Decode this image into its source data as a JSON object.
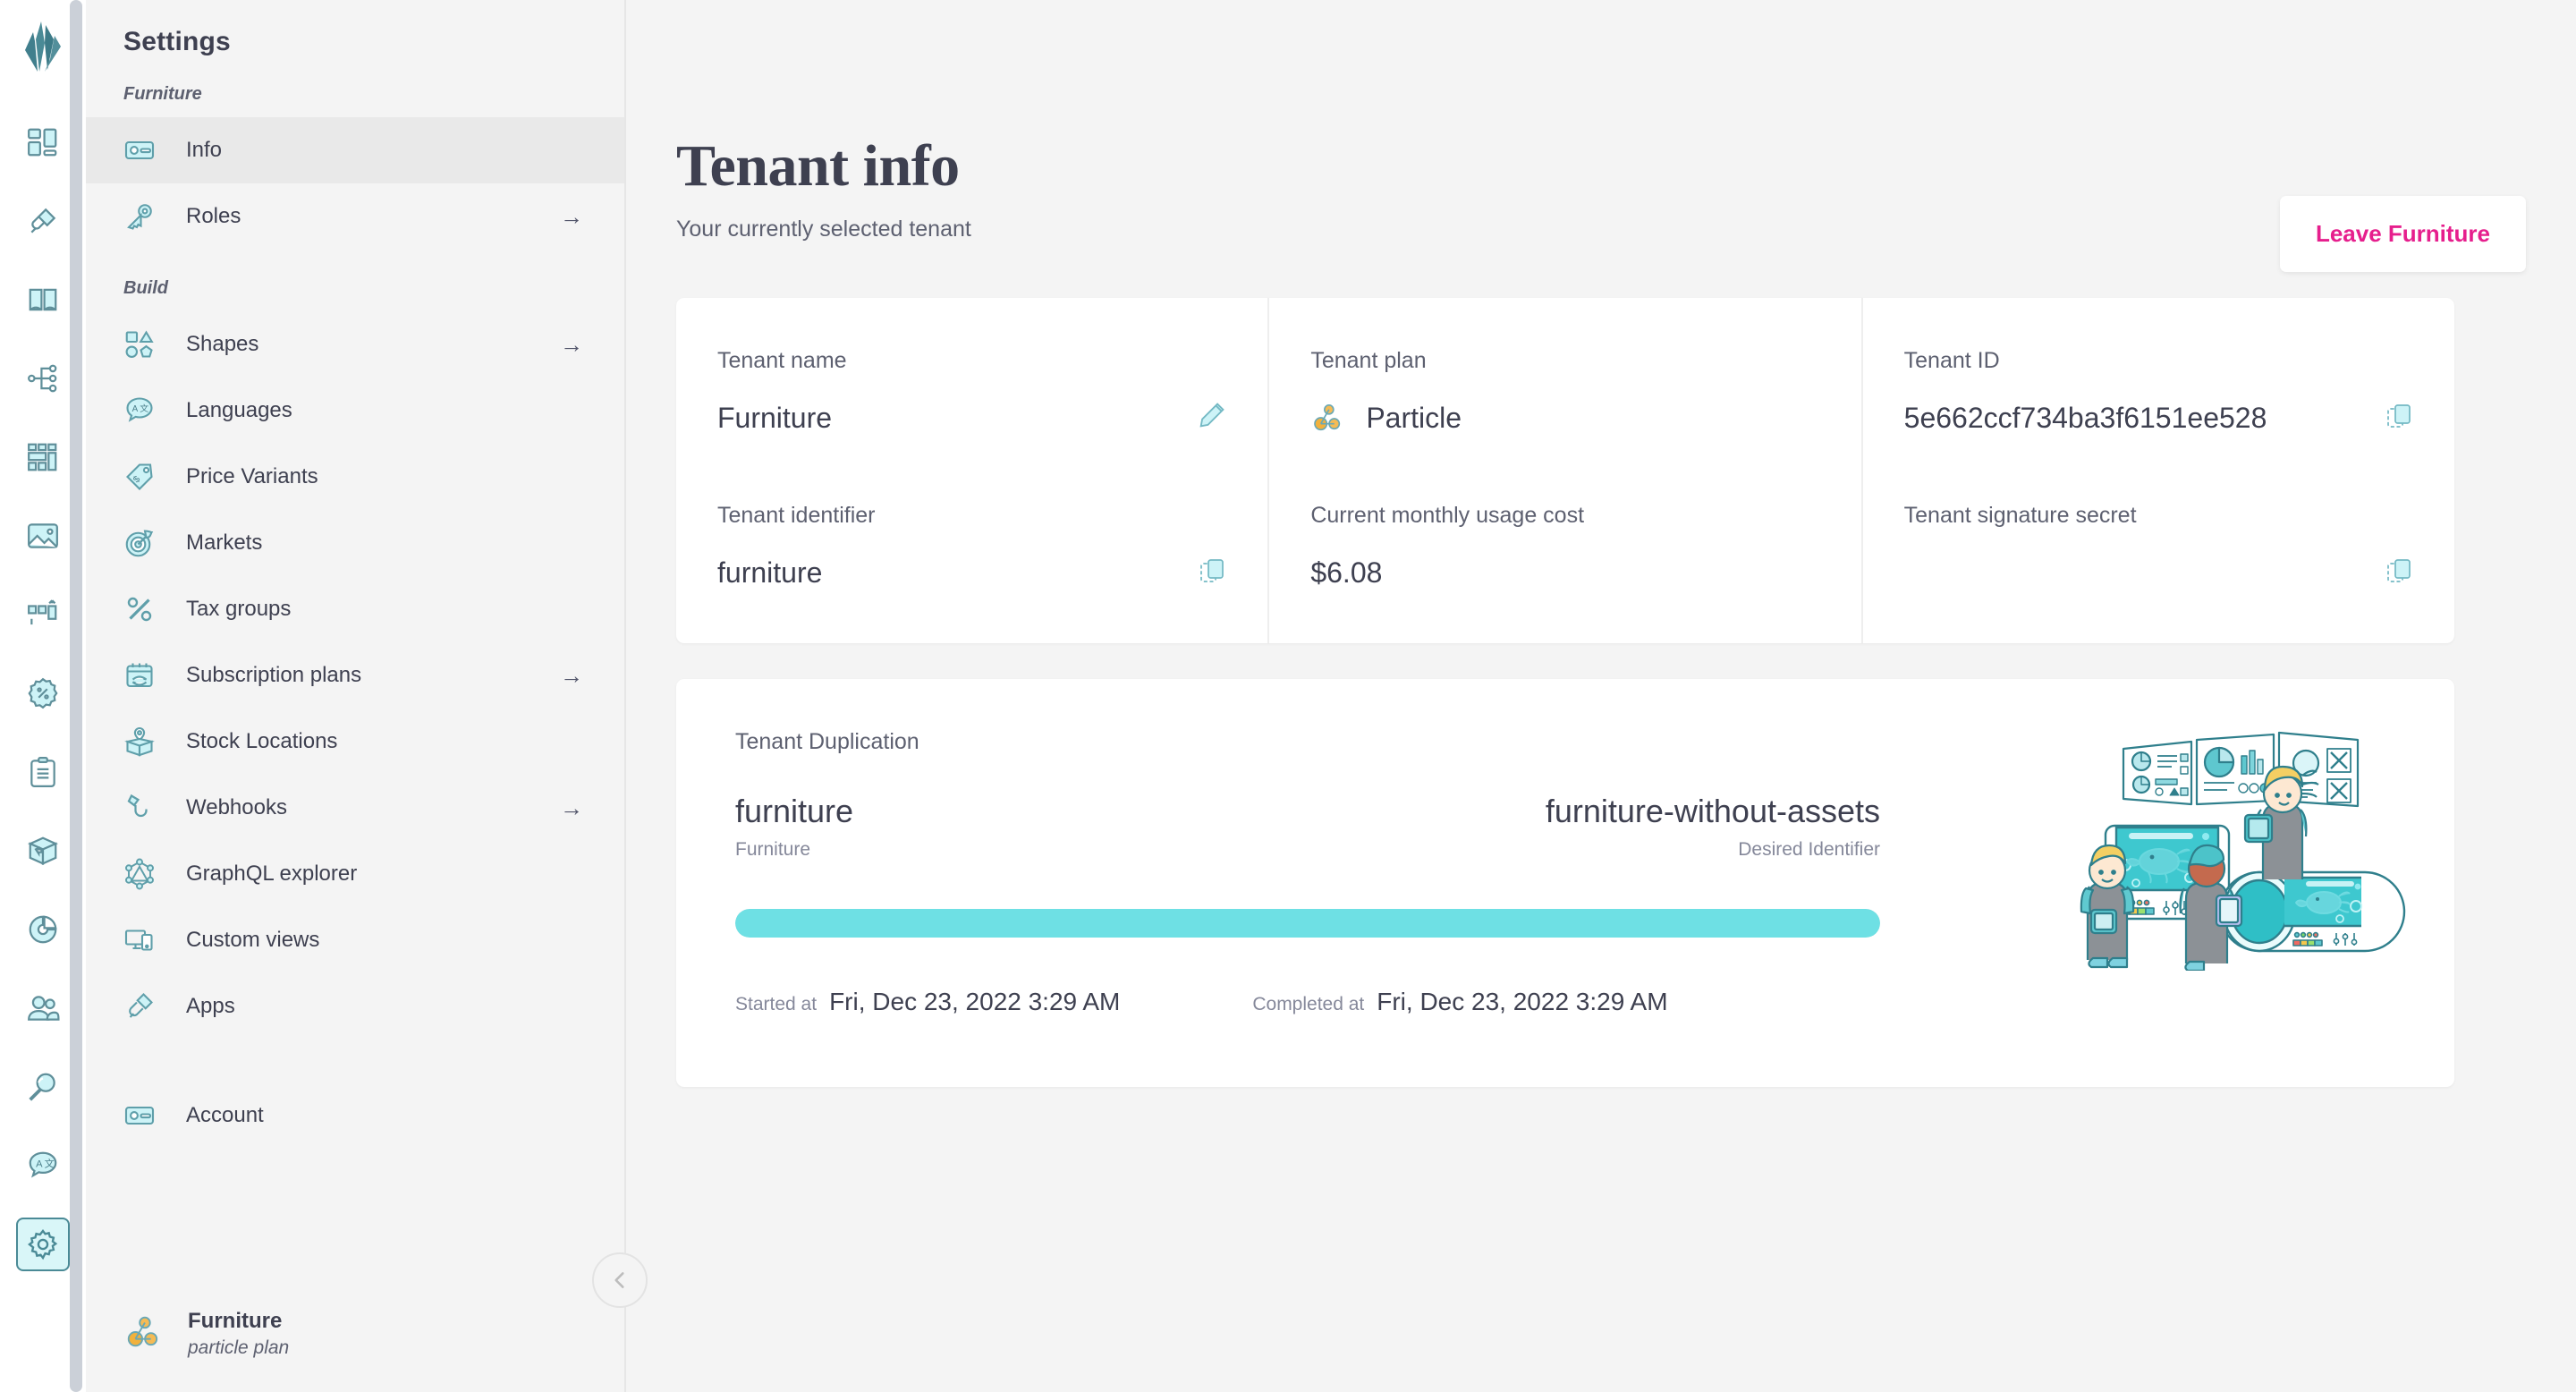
{
  "rail": {
    "logo_icon": "crystallize-logo",
    "items": [
      {
        "icon": "dashboard-icon",
        "name": "dashboard",
        "active": false
      },
      {
        "icon": "plug-icon",
        "name": "apps",
        "active": false
      },
      {
        "icon": "catalogue-book-icon",
        "name": "catalogue",
        "active": false
      },
      {
        "icon": "topics-tree-icon",
        "name": "topics",
        "active": false
      },
      {
        "icon": "grid-layout-icon",
        "name": "grids",
        "active": false
      },
      {
        "icon": "image-icon",
        "name": "media",
        "active": false
      },
      {
        "icon": "pim-upload-icon",
        "name": "import",
        "active": false
      },
      {
        "icon": "discount-badge-icon",
        "name": "discounts",
        "active": false
      },
      {
        "icon": "clipboard-icon",
        "name": "orders",
        "active": false
      },
      {
        "icon": "package-box-icon",
        "name": "shipments",
        "active": false
      },
      {
        "icon": "pie-chart-icon",
        "name": "analytics",
        "active": false
      },
      {
        "icon": "users-icon",
        "name": "customers",
        "active": false
      },
      {
        "icon": "search-icon",
        "name": "search",
        "active": false
      },
      {
        "icon": "translate-icon",
        "name": "translations",
        "active": false
      },
      {
        "icon": "gear-icon",
        "name": "settings",
        "active": true
      }
    ]
  },
  "sidebar": {
    "title": "Settings",
    "groups": [
      {
        "label": "Furniture",
        "items": [
          {
            "label": "Info",
            "icon": "id-card-icon",
            "active": true,
            "arrow": false
          },
          {
            "label": "Roles",
            "icon": "key-icon",
            "active": false,
            "arrow": true
          }
        ]
      },
      {
        "label": "Build",
        "items": [
          {
            "label": "Shapes",
            "icon": "shapes-icon",
            "active": false,
            "arrow": true
          },
          {
            "label": "Languages",
            "icon": "translate-icon",
            "active": false,
            "arrow": false
          },
          {
            "label": "Price Variants",
            "icon": "price-tag-icon",
            "active": false,
            "arrow": false
          },
          {
            "label": "Markets",
            "icon": "target-icon",
            "active": false,
            "arrow": false
          },
          {
            "label": "Tax groups",
            "icon": "percent-icon",
            "active": false,
            "arrow": false
          },
          {
            "label": "Subscription plans",
            "icon": "calendar-refresh-icon",
            "active": false,
            "arrow": true
          },
          {
            "label": "Stock Locations",
            "icon": "stock-pin-box-icon",
            "active": false,
            "arrow": false
          },
          {
            "label": "Webhooks",
            "icon": "hook-icon",
            "active": false,
            "arrow": true
          },
          {
            "label": "GraphQL explorer",
            "icon": "graphql-icon",
            "active": false,
            "arrow": false
          },
          {
            "label": "Custom views",
            "icon": "devices-icon",
            "active": false,
            "arrow": false
          },
          {
            "label": "Apps",
            "icon": "plug-icon",
            "active": false,
            "arrow": false
          }
        ]
      },
      {
        "label": "",
        "items": [
          {
            "label": "Account",
            "icon": "id-card-icon",
            "active": false,
            "arrow": false
          }
        ]
      }
    ],
    "footer": {
      "icon": "particle-plan-icon",
      "tenant_name": "Furniture",
      "plan_name": "particle plan"
    },
    "collapse_icon": "chevron-left-icon"
  },
  "main": {
    "title": "Tenant info",
    "subtitle": "Your currently selected tenant",
    "leave_button": "Leave Furniture",
    "accent_pink": "#e61f8d",
    "cards": [
      {
        "fields": [
          {
            "label": "Tenant name",
            "value": "Furniture",
            "action_icon": "pencil-edit-icon"
          },
          {
            "label": "Tenant identifier",
            "value": "furniture",
            "action_icon": "copy-icon"
          }
        ]
      },
      {
        "fields": [
          {
            "label": "Tenant plan",
            "value": "Particle",
            "value_icon": "particle-plan-icon",
            "action_icon": ""
          },
          {
            "label": "Current monthly usage cost",
            "value": "$6.08",
            "action_icon": ""
          }
        ]
      },
      {
        "fields": [
          {
            "label": "Tenant ID",
            "value": "5e662ccf734ba3f6151ee528",
            "action_icon": "copy-icon"
          },
          {
            "label": "Tenant signature secret",
            "value": "",
            "action_icon": "copy-icon"
          }
        ]
      }
    ],
    "duplication": {
      "title": "Tenant Duplication",
      "source_identifier": "furniture",
      "source_caption": "Furniture",
      "target_identifier": "furniture-without-assets",
      "target_caption": "Desired Identifier",
      "progress_percent": 100,
      "progress_color": "#6ee0e4",
      "started_label": "Started at",
      "started_value": "Fri, Dec 23, 2022 3:29 AM",
      "completed_label": "Completed at",
      "completed_value": "Fri, Dec 23, 2022 3:29 AM",
      "illustration": "lab-scientists-tanks-illustration"
    }
  }
}
